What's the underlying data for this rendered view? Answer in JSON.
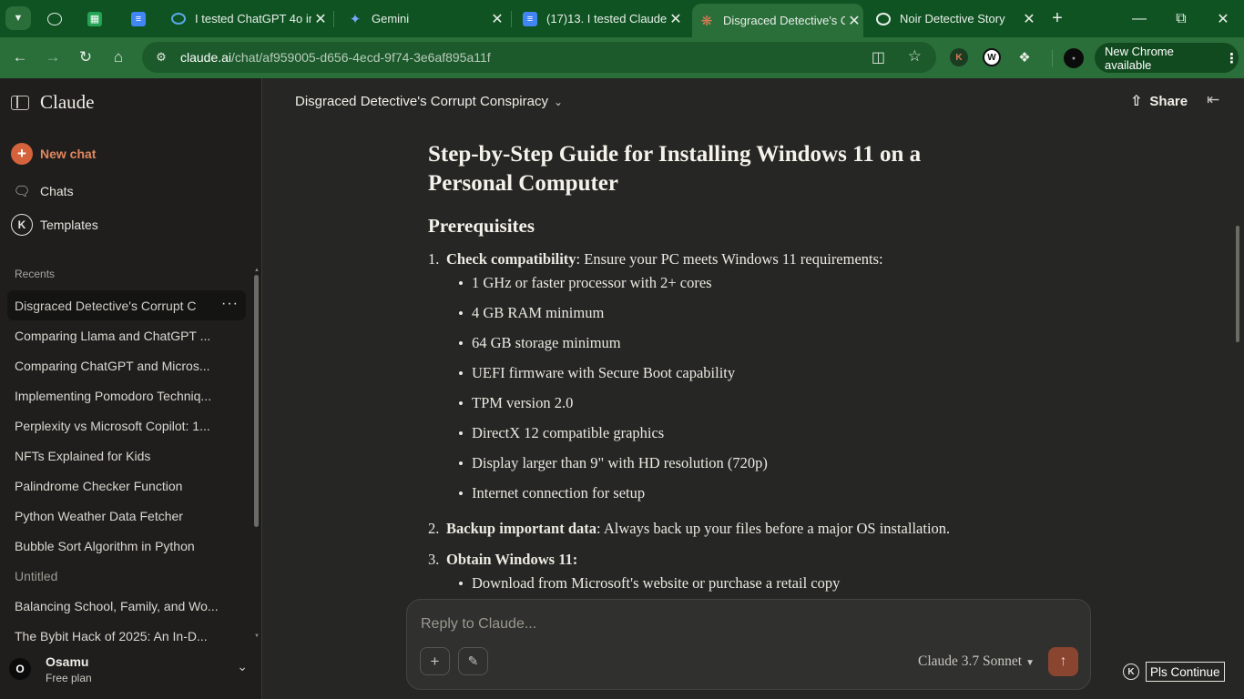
{
  "browser": {
    "tabs": [
      {
        "title": "",
        "icon": "globe-icon"
      },
      {
        "title": "",
        "icon": "sheets-icon"
      },
      {
        "title": "",
        "icon": "docs-icon"
      },
      {
        "title": "I tested ChatGPT 4o im",
        "icon": "chatgpt-circle-icon"
      },
      {
        "title": "Gemini",
        "icon": "gemini-sparkle-icon"
      },
      {
        "title": "(17)13. I tested Claude",
        "icon": "docs-icon"
      },
      {
        "title": "Disgraced Detective's C",
        "icon": "claude-starburst-icon"
      },
      {
        "title": "Noir Detective Story",
        "icon": "openai-icon"
      }
    ],
    "url_host": "claude.ai",
    "url_path": "/chat/af959005-d656-4ecd-9f74-3e6af895a11f",
    "update_label": "New Chrome available",
    "accent_colors": {
      "frame": "#0f5323",
      "toolbar": "#2a6e3a"
    }
  },
  "sidebar": {
    "brand": "Claude",
    "new_chat": "New chat",
    "chats": "Chats",
    "templates": "Templates",
    "recents_label": "Recents",
    "recents": [
      "Disgraced Detective's Corrupt C",
      "Comparing Llama and ChatGPT ...",
      "Comparing ChatGPT and Micros...",
      "Implementing Pomodoro Techniq...",
      "Perplexity vs Microsoft Copilot: 1...",
      "NFTs Explained for Kids",
      "Palindrome Checker Function",
      "Python Weather Data Fetcher",
      "Bubble Sort Algorithm in Python",
      "Untitled",
      "Balancing School, Family, and Wo...",
      "The Bybit Hack of 2025: An In-D..."
    ],
    "user": {
      "initial": "O",
      "name": "Osamu",
      "plan": "Free plan"
    }
  },
  "main": {
    "conversation_title": "Disgraced Detective's Corrupt Conspiracy",
    "share_label": "Share",
    "heading": "Step-by-Step Guide for Installing Windows 11 on a Personal Computer",
    "subheading": "Prerequisites",
    "steps": [
      {
        "num": "1.",
        "bold": "Check compatibility",
        "text": ": Ensure your PC meets Windows 11 requirements:",
        "bullets": [
          "1 GHz or faster processor with 2+ cores",
          "4 GB RAM minimum",
          "64 GB storage minimum",
          "UEFI firmware with Secure Boot capability",
          "TPM version 2.0",
          "DirectX 12 compatible graphics",
          "Display larger than 9\" with HD resolution (720p)",
          "Internet connection for setup"
        ]
      },
      {
        "num": "2.",
        "bold": "Backup important data",
        "text": ": Always back up your files before a major OS installation.",
        "bullets": []
      },
      {
        "num": "3.",
        "bold": "Obtain Windows 11:",
        "text": "",
        "bullets": [
          "Download from Microsoft's website or purchase a retail copy"
        ]
      }
    ],
    "composer": {
      "placeholder": "Reply to Claude...",
      "model": "Claude 3.7 Sonnet"
    },
    "extension_button": "Pls Continue"
  }
}
